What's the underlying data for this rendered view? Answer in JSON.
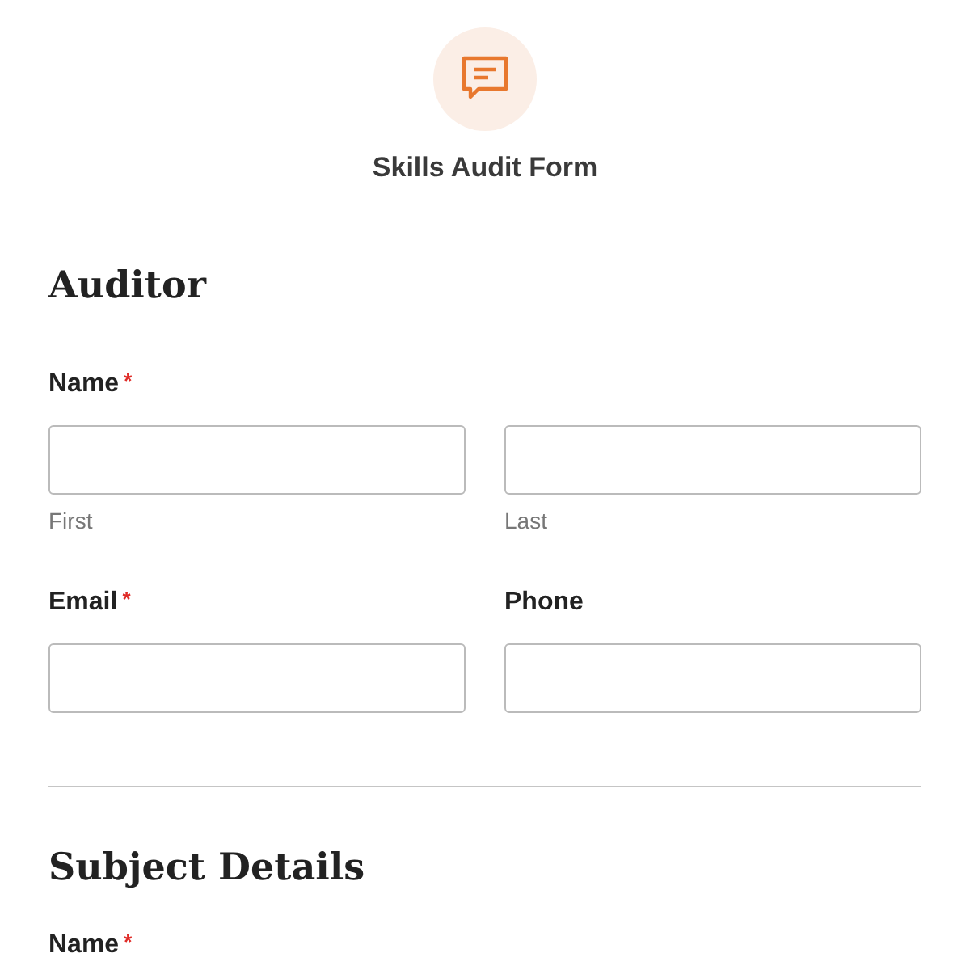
{
  "form_title": "Skills Audit Form",
  "required_mark": "*",
  "sections": [
    {
      "heading": "Auditor",
      "divider": true,
      "rows": [
        {
          "fields": [
            {
              "label": "Name",
              "required": true,
              "kind": "split",
              "sublabels": [
                "First",
                "Last"
              ]
            }
          ]
        },
        {
          "fields": [
            {
              "label": "Email",
              "required": true,
              "kind": "single"
            },
            {
              "label": "Phone",
              "required": false,
              "kind": "single"
            }
          ]
        }
      ]
    },
    {
      "heading": "Subject Details",
      "divider": false,
      "rows": [
        {
          "fields": [
            {
              "label": "Name",
              "required": true,
              "kind": "label_only"
            }
          ]
        }
      ]
    }
  ]
}
